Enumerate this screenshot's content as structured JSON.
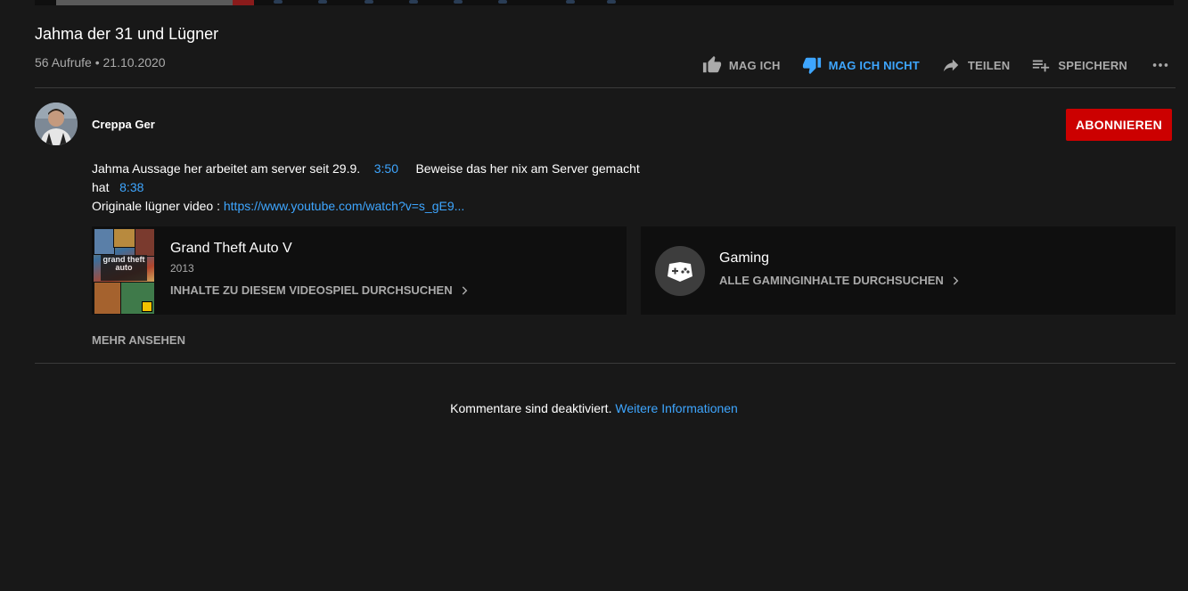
{
  "video": {
    "title": "Jahma der 31 und Lügner",
    "views": "56 Aufrufe",
    "separator": " • ",
    "date": "21.10.2020"
  },
  "actions": {
    "like": "MAG ICH",
    "dislike": "MAG ICH NICHT",
    "share": "TEILEN",
    "save": "SPEICHERN"
  },
  "channel": {
    "name": "Creppa Ger",
    "subscribe": "ABONNIEREN"
  },
  "description": {
    "line1_text": "Jahma Aussage her arbeitet am server seit 29.9.",
    "line1_ts": "3:50",
    "line1_text2": "Beweise das her nix am Server gemacht",
    "line2_text": "hat",
    "line2_ts": "8:38",
    "line3_text": "Originale lügner video : ",
    "line3_link": "https://www.youtube.com/watch?v=s_gE9..."
  },
  "cards": {
    "game": {
      "name": "Grand Theft Auto V",
      "year": "2013",
      "browse": "INHALTE ZU DIESEM VIDEOSPIEL DURCHSUCHEN",
      "cover_text": "grand theft auto"
    },
    "gaming": {
      "name": "Gaming",
      "browse": "ALLE GAMINGINHALTE DURCHSUCHEN"
    }
  },
  "show_more": "MEHR ANSEHEN",
  "comments": {
    "text": "Kommentare sind deaktiviert.",
    "link": "Weitere Informationen"
  },
  "colors": {
    "background": "#181818",
    "accent_blue": "#3ea6ff",
    "subscribe_red": "#cc0000",
    "secondary_text": "#aaaaaa"
  },
  "icons": {
    "like": "thumbs-up-icon",
    "dislike": "thumbs-down-icon",
    "share": "share-arrow-icon",
    "save": "playlist-add-icon",
    "more": "more-horiz-icon",
    "chevron": "chevron-right-icon",
    "gaming": "gamepad-icon"
  }
}
